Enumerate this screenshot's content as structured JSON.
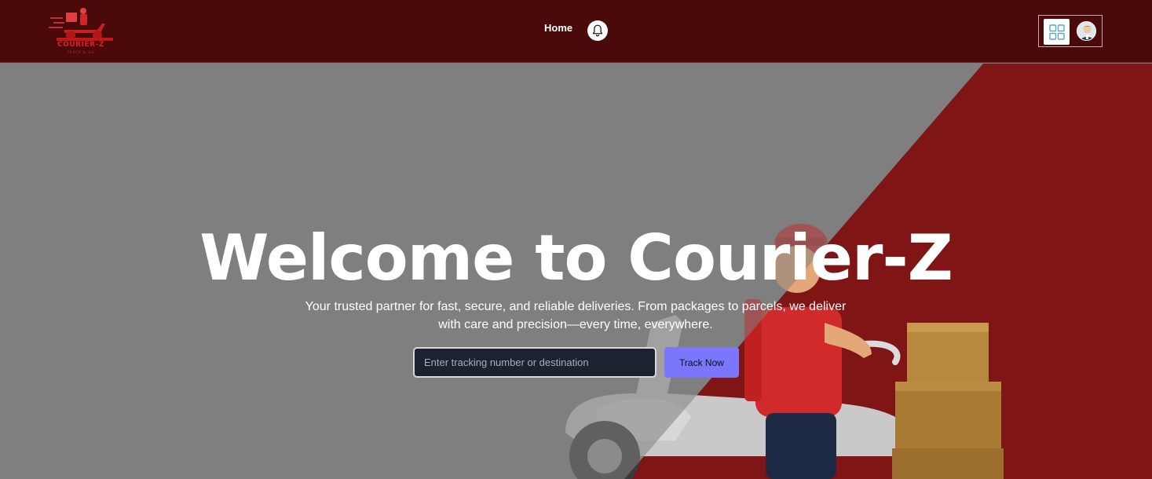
{
  "brand": {
    "name": "COURIER-Z",
    "tagline": "TRACK & GO",
    "colors": {
      "navbar": "#4a0a0a",
      "accent_red": "#8c1414",
      "button": "#7b76fc"
    }
  },
  "nav": {
    "home_label": "Home",
    "notification_icon": "bell-icon",
    "app_icon": "apps-grid-icon",
    "avatar_icon": "user-avatar"
  },
  "hero": {
    "title": "Welcome to Courier-Z",
    "subtitle": "Your trusted partner for fast, secure, and reliable deliveries. From packages to parcels, we deliver with care and precision—every time, everywhere.",
    "search": {
      "placeholder": "Enter tracking number or destination",
      "value": ""
    },
    "track_button_label": "Track Now"
  }
}
